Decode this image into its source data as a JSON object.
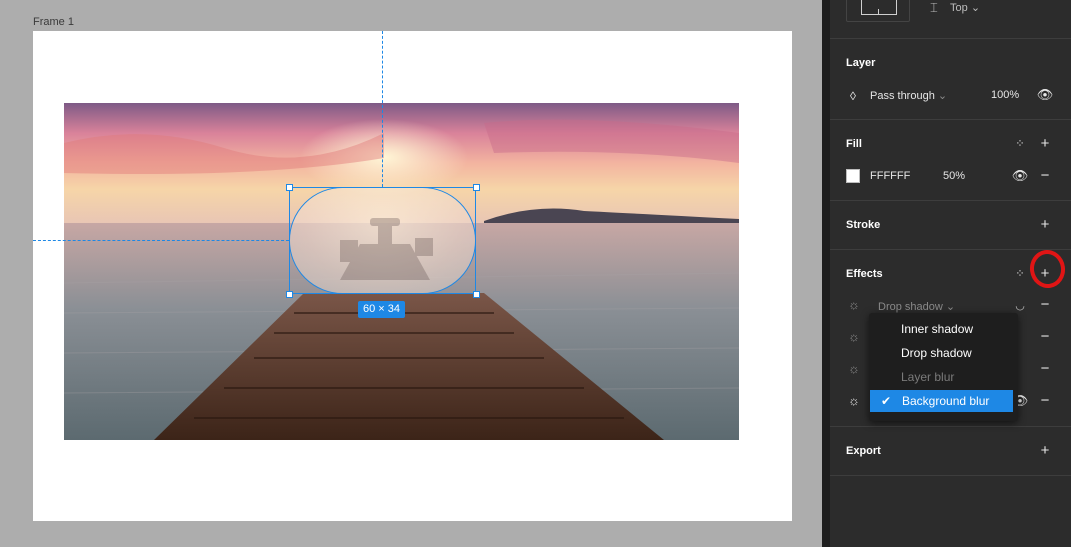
{
  "canvas": {
    "frame_label": "Frame 1",
    "dimension_badge": "60 × 34"
  },
  "panel": {
    "constraints": {
      "vertical_label": "Top"
    },
    "layer": {
      "title": "Layer",
      "blend_mode": "Pass through",
      "opacity": "100%"
    },
    "fill": {
      "title": "Fill",
      "hex": "FFFFFF",
      "opacity": "50%",
      "color": "#FFFFFF"
    },
    "stroke": {
      "title": "Stroke"
    },
    "effects": {
      "title": "Effects",
      "row1_type": "Drop shadow"
    },
    "export": {
      "title": "Export"
    }
  },
  "effect_menu": {
    "items": [
      {
        "label": "Inner shadow",
        "state": "enabled"
      },
      {
        "label": "Drop shadow",
        "state": "enabled"
      },
      {
        "label": "Layer blur",
        "state": "disabled"
      },
      {
        "label": "Background blur",
        "state": "selected"
      }
    ]
  },
  "colors": {
    "accent": "#1E88E5",
    "panel_bg": "#2C2C2C",
    "annotation": "#E01515"
  }
}
